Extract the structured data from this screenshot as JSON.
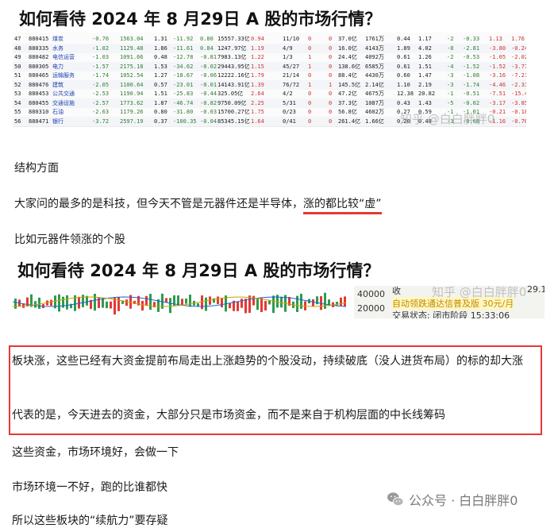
{
  "title": "如何看待 2024 年 8 月29日 A 股的市场行情？",
  "table": {
    "rows": [
      {
        "idx": "47",
        "code": "880415",
        "name": "煤炭",
        "chg": "-0.76",
        "price": "1563.04",
        "a": "1.31",
        "b": "-11.92",
        "c": "0.80",
        "d": "15557.33亿",
        "e": "0.94",
        "f": "11/10",
        "g": "0",
        "h": "0",
        "i": "37.0亿",
        "j": "1761万",
        "k": "0.44",
        "l": "1.17",
        "m": "-2",
        "n": "-0.33",
        "o": "1.13",
        "p": "1.76"
      },
      {
        "idx": "48",
        "code": "880335",
        "name": "水务",
        "chg": "-1.02",
        "price": "1129.48",
        "a": "1.86",
        "b": "-11.61",
        "c": "0.84",
        "d": "1247.97亿",
        "e": "1.19",
        "f": "4/9",
        "g": "0",
        "h": "0",
        "i": "16.0亿",
        "j": "4143万",
        "k": "1.89",
        "l": "4.02",
        "m": "-8",
        "n": "-2.81",
        "o": "-3.80",
        "p": "-0.24"
      },
      {
        "idx": "49",
        "code": "880482",
        "name": "电信运营",
        "chg": "-1.03",
        "price": "1091.66",
        "a": "0.48",
        "b": "-12.78",
        "c": "-0.81",
        "d": "7983.13亿",
        "e": "1.22",
        "f": "1/3",
        "g": "1",
        "h": "0",
        "i": "24.4亿",
        "j": "4092万",
        "k": "0.61",
        "l": "1.26",
        "m": "-2",
        "n": "-0.53",
        "o": "-1.05",
        "p": "-2.02"
      },
      {
        "idx": "50",
        "code": "880305",
        "name": "电力",
        "chg": "-1.57",
        "price": "2175.18",
        "a": "1.53",
        "b": "-34.62",
        "c": "-0.02",
        "d": "29443.95亿",
        "e": "1.15",
        "f": "45/27",
        "g": "1",
        "h": "0",
        "i": "138.6亿",
        "j": "6585万",
        "k": "0.61",
        "l": "1.51",
        "m": "-4",
        "n": "-1.52",
        "o": "-1.52",
        "p": "-3.77"
      },
      {
        "idx": "51",
        "code": "880465",
        "name": "运输服务",
        "chg": "-1.74",
        "price": "1052.54",
        "a": "1.27",
        "b": "-18.67",
        "c": "-0.06",
        "d": "12222.16亿",
        "e": "1.79",
        "f": "21/14",
        "g": "0",
        "h": "0",
        "i": "88.4亿",
        "j": "4430万",
        "k": "0.60",
        "l": "1.47",
        "m": "-3",
        "n": "-1.08",
        "o": "-3.16",
        "p": "-7.21"
      },
      {
        "idx": "52",
        "code": "880476",
        "name": "建筑",
        "chg": "-2.05",
        "price": "1100.64",
        "a": "0.57",
        "b": "-23.01",
        "c": "-0.01",
        "d": "14143.91亿",
        "e": "1.39",
        "f": "76/72",
        "g": "1",
        "h": "1",
        "i": "145.5亿",
        "j": "2.14亿",
        "k": "1.10",
        "l": "2.19",
        "m": "-3",
        "n": "-1.74",
        "o": "-4.46",
        "p": "-2.31"
      },
      {
        "idx": "53",
        "code": "880453",
        "name": "公共交通",
        "chg": "-2.53",
        "price": "1190.94",
        "a": "1.51",
        "b": "-25.83",
        "c": "-0.44",
        "d": "325.05亿",
        "e": "2.64",
        "f": "4/2",
        "g": "0",
        "h": "0",
        "i": "47.2亿",
        "j": "4675万",
        "k": "12.38",
        "l": "20.82",
        "m": "-1",
        "n": "-0.51",
        "o": "-7.51",
        "p": "-15.45"
      },
      {
        "idx": "54",
        "code": "880455",
        "name": "交通设施",
        "chg": "-2.57",
        "price": "1773.62",
        "a": "1.87",
        "b": "-46.74",
        "c": "-0.82",
        "d": "9750.09亿",
        "e": "2.25",
        "f": "5/31",
        "g": "0",
        "h": "0",
        "i": "37.3亿",
        "j": "1087万",
        "k": "0.43",
        "l": "1.43",
        "m": "-5",
        "n": "-0.02",
        "o": "-3.17",
        "p": "-3.85"
      },
      {
        "idx": "55",
        "code": "880310",
        "name": "石油",
        "chg": "-2.63",
        "price": "1179.26",
        "a": "0.80",
        "b": "-31.80",
        "c": "-0.03",
        "d": "15700.27亿",
        "e": "1.75",
        "f": "0/23",
        "g": "0",
        "h": "0",
        "i": "56.8亿",
        "j": "4602万",
        "k": "0.27",
        "l": "0.59",
        "m": "-1",
        "n": "-1.01",
        "o": "-0.21",
        "p": "-0.18"
      },
      {
        "idx": "56",
        "code": "880471",
        "name": "银行",
        "chg": "-3.72",
        "price": "2597.19",
        "a": "0.37",
        "b": "-100.35",
        "c": "-0.04",
        "d": "85345.15亿",
        "e": "1.64",
        "f": "0/41",
        "g": "0",
        "h": "0",
        "i": "261.4亿",
        "j": "1.66亿",
        "k": "0.20",
        "l": "0.48",
        "m": "-3",
        "n": "-0.08",
        "o": "-1.16",
        "p": "-0.76"
      }
    ],
    "watermark": "知乎 @白白胖胖0"
  },
  "section_heading": "结构方面",
  "para2_pre": "大家问的最多的是科技，但今天不管是元器件还是半导体，",
  "para2_underlined": "涨的都比较“虚”",
  "para3": "比如元器件领涨的个股",
  "kline": {
    "axis_1": "40000",
    "axis_2": "20000",
    "info_1": "收",
    "info_2": "29.1",
    "info_3": "自动领跌通达信普及版 30元/月",
    "info_4": "交易状态: 闭市阶段 15:33:06",
    "watermark": "知乎 @白白胖胖0"
  },
  "box": {
    "text1": "板块涨，这些已经有大资金提前布局走出上涨趋势的个股没动，持续破底（没人进货布局）的标的却大涨",
    "text2": "代表的是，今天进去的资金，大部分只是市场资金，而不是来自于机构层面的中长线筹码"
  },
  "para4": "这些资金，市场环境好，会做一下",
  "para5": "市场环境一不好，跑的比谁都快",
  "para6": "所以这些板块的“续航力”要存疑",
  "footer_watermark": "公众号 · 白白胖胖0",
  "colors": {
    "accent_red": "#e53935",
    "rise": "#d32f2f",
    "fall": "#2e7d32"
  }
}
